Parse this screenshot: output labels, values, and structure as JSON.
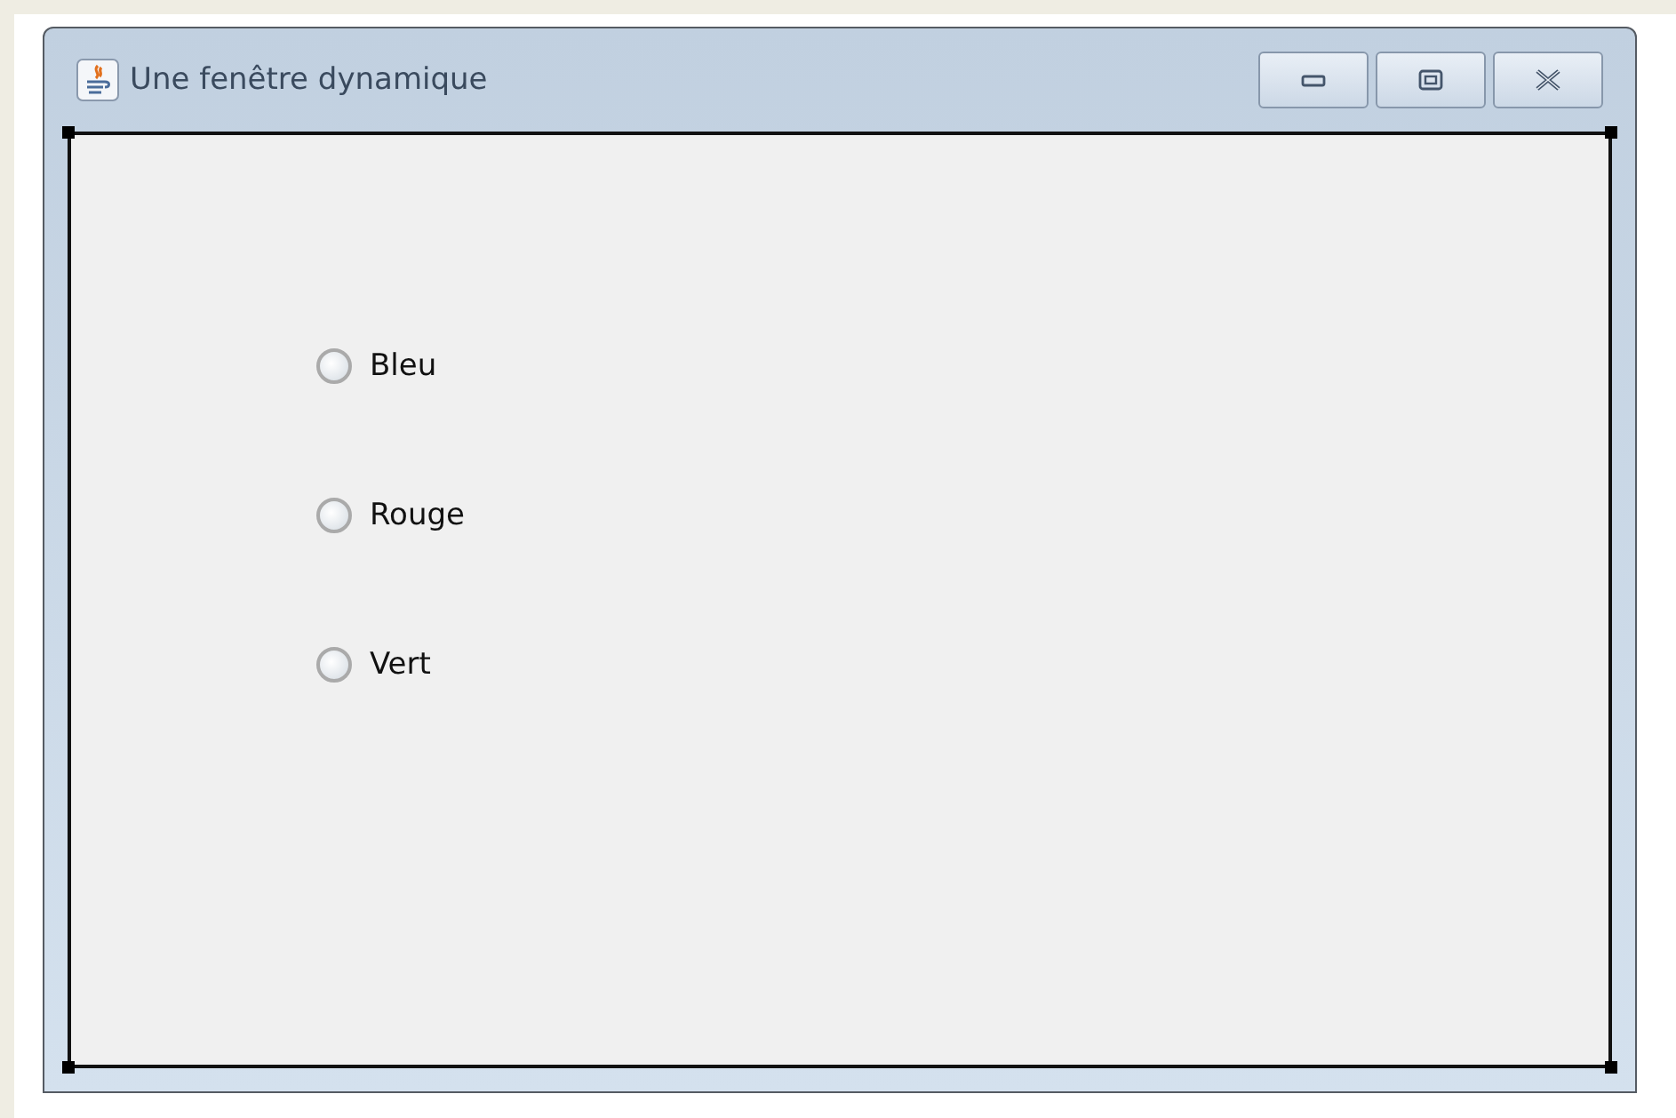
{
  "window": {
    "title": "Une fenêtre dynamique"
  },
  "radios": [
    {
      "label": "Bleu",
      "selected": false
    },
    {
      "label": "Rouge",
      "selected": false
    },
    {
      "label": "Vert",
      "selected": false
    }
  ]
}
